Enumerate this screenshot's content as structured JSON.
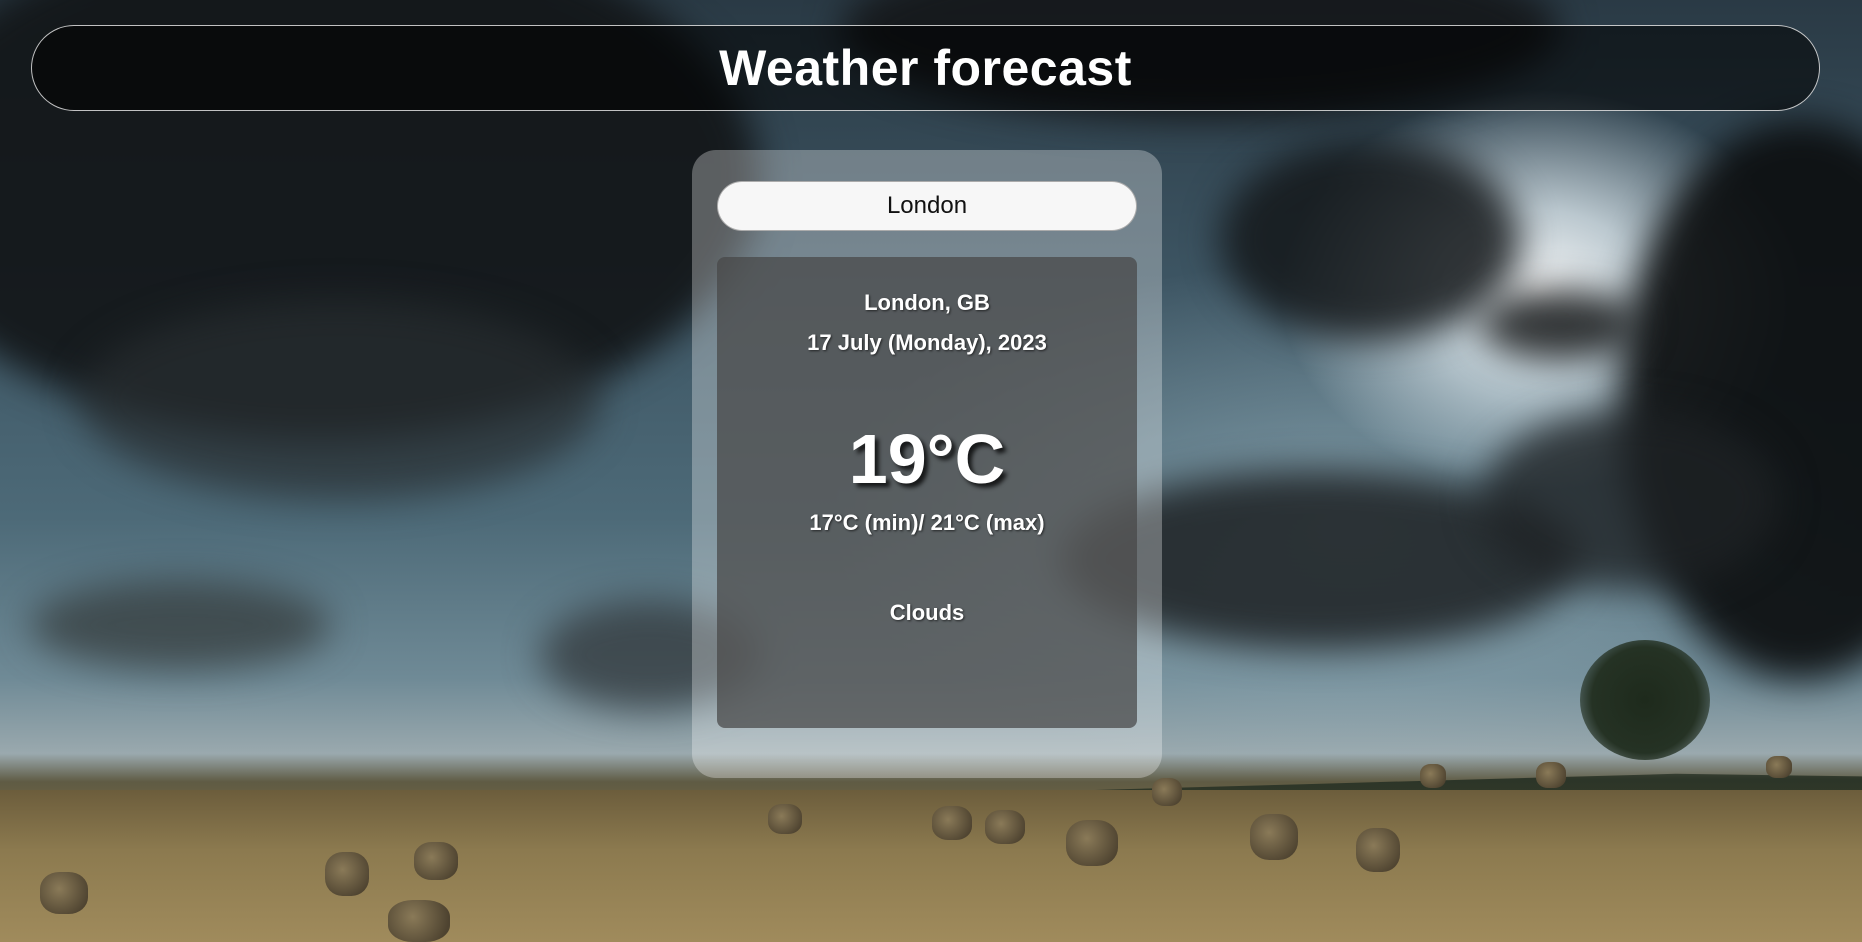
{
  "header": {
    "title": "Weather forecast"
  },
  "search": {
    "value": "London",
    "placeholder": ""
  },
  "weather": {
    "location": "London, GB",
    "date": "17 July (Monday), 2023",
    "temperature": "19°C",
    "min_max": "17°C (min)/ 21°C (max)",
    "condition": "Clouds"
  },
  "colors": {
    "header_border": "#ffffff",
    "text": "#ffffff",
    "input_bg": "#f7f7f7"
  }
}
